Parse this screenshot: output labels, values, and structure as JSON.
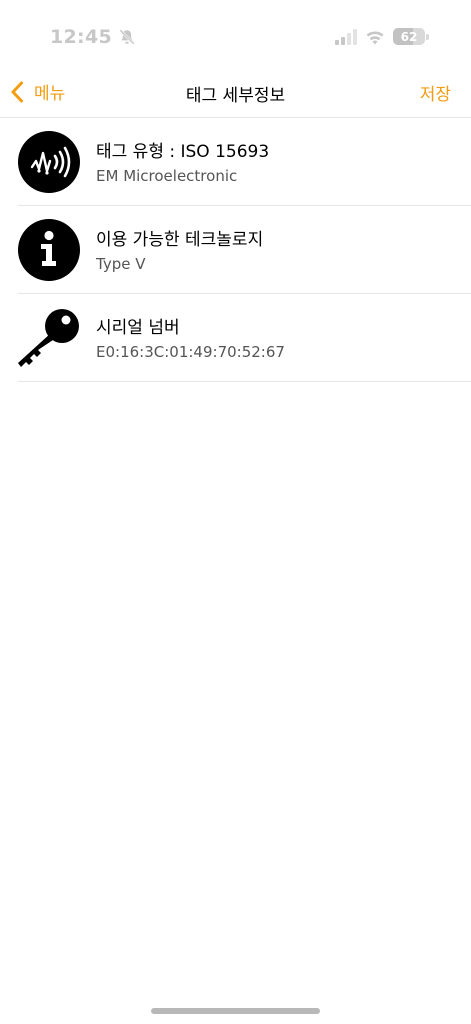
{
  "status_bar": {
    "time": "12:45",
    "battery": "62",
    "battery_level": 0.62,
    "icons": [
      "bell-slash-icon",
      "cellular-signal-icon",
      "wifi-icon",
      "battery-icon"
    ]
  },
  "nav": {
    "back_label": "메뉴",
    "title": "태그 세부정보",
    "save_label": "저장",
    "accent_color": "#f39c12"
  },
  "rows": [
    {
      "icon": "nfc-wave-icon",
      "title": "태그 유형 : ISO 15693",
      "subtitle": "EM Microelectronic"
    },
    {
      "icon": "info-icon",
      "title": "이용 가능한 테크놀로지",
      "subtitle": "Type V"
    },
    {
      "icon": "key-icon",
      "title": "시리얼 넘버",
      "subtitle": "E0:16:3C:01:49:70:52:67"
    }
  ]
}
